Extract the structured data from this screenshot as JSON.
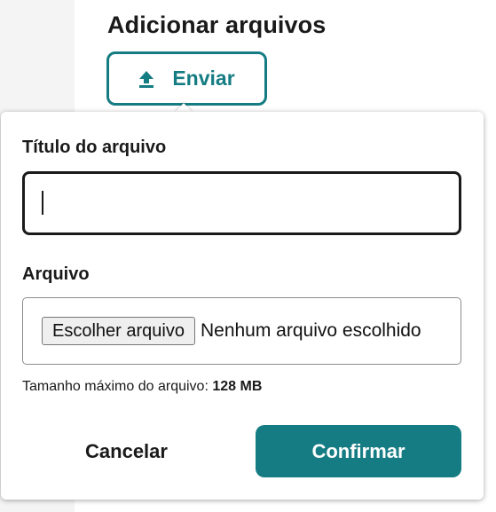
{
  "section": {
    "heading": "Adicionar arquivos"
  },
  "upload_button": {
    "label": "Enviar",
    "icon": "upload-icon"
  },
  "dialog": {
    "title_field": {
      "label": "Título do arquivo",
      "value": "",
      "placeholder": ""
    },
    "file_field": {
      "label": "Arquivo",
      "choose_button_label": "Escolher arquivo",
      "status_text": "Nenhum arquivo escolhido"
    },
    "max_size": {
      "prefix": "Tamanho máximo do arquivo:",
      "value": "128 MB"
    },
    "cancel_label": "Cancelar",
    "confirm_label": "Confirmar"
  },
  "colors": {
    "accent": "#147c82",
    "text": "#1a1a1a",
    "gutter": "#f4f4f4"
  }
}
